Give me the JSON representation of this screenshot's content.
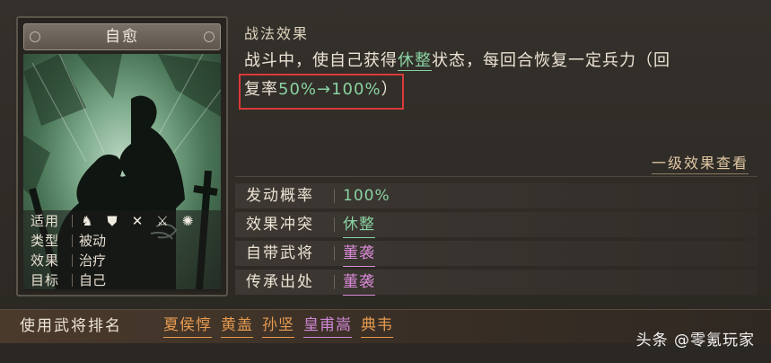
{
  "card": {
    "title": "自愈",
    "rows": [
      {
        "label": "适用",
        "value": ""
      },
      {
        "label": "类型",
        "value": "被动"
      },
      {
        "label": "效果",
        "value": "治疗"
      },
      {
        "label": "目标",
        "value": "自己"
      }
    ],
    "unit_icons": [
      "cavalry-icon",
      "shield-icon",
      "bow-icon",
      "spear-icon",
      "wheel-icon"
    ]
  },
  "effect": {
    "heading": "战法效果",
    "text_a": "战斗中，使自己获得",
    "status": "休整",
    "text_b": "状态，每回合恢复一定兵力（回",
    "text_c": "复率",
    "rate": "50%→100%",
    "text_d": "）",
    "level_link": "一级效果查看"
  },
  "props": [
    {
      "label": "发动概率",
      "value": "100%",
      "color": "#8ad2a2",
      "underline": false
    },
    {
      "label": "效果冲突",
      "value": "休整",
      "color": "#8ad2a2",
      "underline": true
    },
    {
      "label": "自带武将",
      "value": "董袭",
      "color": "#d98ad6",
      "underline": true
    },
    {
      "label": "传承出处",
      "value": "董袭",
      "color": "#d98ad6",
      "underline": true
    }
  ],
  "ranking": {
    "label": "使用武将排名",
    "generals": [
      {
        "name": "夏侯惇",
        "color": "#e59a50"
      },
      {
        "name": "黄盖",
        "color": "#e59a50"
      },
      {
        "name": "孙坚",
        "color": "#e59a50"
      },
      {
        "name": "皇甫嵩",
        "color": "#cf86d6"
      },
      {
        "name": "典韦",
        "color": "#e59a50"
      }
    ]
  },
  "watermark": "头条 @零氪玩家"
}
